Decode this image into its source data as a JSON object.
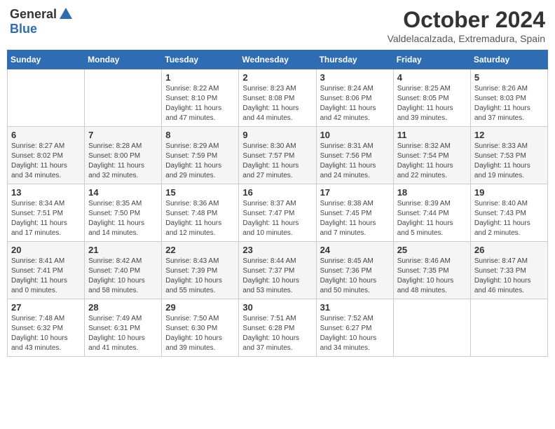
{
  "header": {
    "logo_general": "General",
    "logo_blue": "Blue",
    "month": "October 2024",
    "location": "Valdelacalzada, Extremadura, Spain"
  },
  "days_of_week": [
    "Sunday",
    "Monday",
    "Tuesday",
    "Wednesday",
    "Thursday",
    "Friday",
    "Saturday"
  ],
  "weeks": [
    [
      {
        "day": "",
        "info": ""
      },
      {
        "day": "",
        "info": ""
      },
      {
        "day": "1",
        "info": "Sunrise: 8:22 AM\nSunset: 8:10 PM\nDaylight: 11 hours\nand 47 minutes."
      },
      {
        "day": "2",
        "info": "Sunrise: 8:23 AM\nSunset: 8:08 PM\nDaylight: 11 hours\nand 44 minutes."
      },
      {
        "day": "3",
        "info": "Sunrise: 8:24 AM\nSunset: 8:06 PM\nDaylight: 11 hours\nand 42 minutes."
      },
      {
        "day": "4",
        "info": "Sunrise: 8:25 AM\nSunset: 8:05 PM\nDaylight: 11 hours\nand 39 minutes."
      },
      {
        "day": "5",
        "info": "Sunrise: 8:26 AM\nSunset: 8:03 PM\nDaylight: 11 hours\nand 37 minutes."
      }
    ],
    [
      {
        "day": "6",
        "info": "Sunrise: 8:27 AM\nSunset: 8:02 PM\nDaylight: 11 hours\nand 34 minutes."
      },
      {
        "day": "7",
        "info": "Sunrise: 8:28 AM\nSunset: 8:00 PM\nDaylight: 11 hours\nand 32 minutes."
      },
      {
        "day": "8",
        "info": "Sunrise: 8:29 AM\nSunset: 7:59 PM\nDaylight: 11 hours\nand 29 minutes."
      },
      {
        "day": "9",
        "info": "Sunrise: 8:30 AM\nSunset: 7:57 PM\nDaylight: 11 hours\nand 27 minutes."
      },
      {
        "day": "10",
        "info": "Sunrise: 8:31 AM\nSunset: 7:56 PM\nDaylight: 11 hours\nand 24 minutes."
      },
      {
        "day": "11",
        "info": "Sunrise: 8:32 AM\nSunset: 7:54 PM\nDaylight: 11 hours\nand 22 minutes."
      },
      {
        "day": "12",
        "info": "Sunrise: 8:33 AM\nSunset: 7:53 PM\nDaylight: 11 hours\nand 19 minutes."
      }
    ],
    [
      {
        "day": "13",
        "info": "Sunrise: 8:34 AM\nSunset: 7:51 PM\nDaylight: 11 hours\nand 17 minutes."
      },
      {
        "day": "14",
        "info": "Sunrise: 8:35 AM\nSunset: 7:50 PM\nDaylight: 11 hours\nand 14 minutes."
      },
      {
        "day": "15",
        "info": "Sunrise: 8:36 AM\nSunset: 7:48 PM\nDaylight: 11 hours\nand 12 minutes."
      },
      {
        "day": "16",
        "info": "Sunrise: 8:37 AM\nSunset: 7:47 PM\nDaylight: 11 hours\nand 10 minutes."
      },
      {
        "day": "17",
        "info": "Sunrise: 8:38 AM\nSunset: 7:45 PM\nDaylight: 11 hours\nand 7 minutes."
      },
      {
        "day": "18",
        "info": "Sunrise: 8:39 AM\nSunset: 7:44 PM\nDaylight: 11 hours\nand 5 minutes."
      },
      {
        "day": "19",
        "info": "Sunrise: 8:40 AM\nSunset: 7:43 PM\nDaylight: 11 hours\nand 2 minutes."
      }
    ],
    [
      {
        "day": "20",
        "info": "Sunrise: 8:41 AM\nSunset: 7:41 PM\nDaylight: 11 hours\nand 0 minutes."
      },
      {
        "day": "21",
        "info": "Sunrise: 8:42 AM\nSunset: 7:40 PM\nDaylight: 10 hours\nand 58 minutes."
      },
      {
        "day": "22",
        "info": "Sunrise: 8:43 AM\nSunset: 7:39 PM\nDaylight: 10 hours\nand 55 minutes."
      },
      {
        "day": "23",
        "info": "Sunrise: 8:44 AM\nSunset: 7:37 PM\nDaylight: 10 hours\nand 53 minutes."
      },
      {
        "day": "24",
        "info": "Sunrise: 8:45 AM\nSunset: 7:36 PM\nDaylight: 10 hours\nand 50 minutes."
      },
      {
        "day": "25",
        "info": "Sunrise: 8:46 AM\nSunset: 7:35 PM\nDaylight: 10 hours\nand 48 minutes."
      },
      {
        "day": "26",
        "info": "Sunrise: 8:47 AM\nSunset: 7:33 PM\nDaylight: 10 hours\nand 46 minutes."
      }
    ],
    [
      {
        "day": "27",
        "info": "Sunrise: 7:48 AM\nSunset: 6:32 PM\nDaylight: 10 hours\nand 43 minutes."
      },
      {
        "day": "28",
        "info": "Sunrise: 7:49 AM\nSunset: 6:31 PM\nDaylight: 10 hours\nand 41 minutes."
      },
      {
        "day": "29",
        "info": "Sunrise: 7:50 AM\nSunset: 6:30 PM\nDaylight: 10 hours\nand 39 minutes."
      },
      {
        "day": "30",
        "info": "Sunrise: 7:51 AM\nSunset: 6:28 PM\nDaylight: 10 hours\nand 37 minutes."
      },
      {
        "day": "31",
        "info": "Sunrise: 7:52 AM\nSunset: 6:27 PM\nDaylight: 10 hours\nand 34 minutes."
      },
      {
        "day": "",
        "info": ""
      },
      {
        "day": "",
        "info": ""
      }
    ]
  ]
}
